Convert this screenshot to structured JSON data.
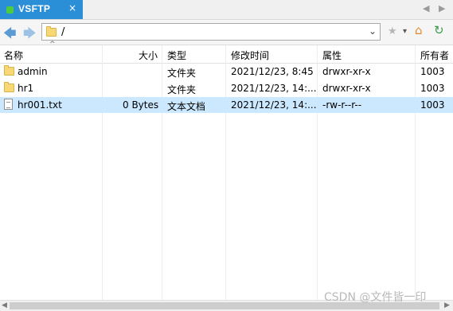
{
  "tab": {
    "title": "VSFTP",
    "close": "×"
  },
  "tab_nav": {
    "left": "◀",
    "right": "▶"
  },
  "toolbar": {
    "back": "🡄",
    "forward": "🡆",
    "path": "/",
    "path_dropdown": "⌄",
    "star": "★",
    "star_drop": "▾",
    "home": "⌂",
    "refresh": "↻"
  },
  "columns": {
    "name": "名称",
    "sort_indicator": "^",
    "size": "大小",
    "type": "类型",
    "modified": "修改时间",
    "attrs": "属性",
    "owner": "所有者"
  },
  "files": [
    {
      "name": "admin",
      "size": "",
      "type": "文件夹",
      "modified": "2021/12/23, 8:45",
      "attrs": "drwxr-xr-x",
      "owner": "1003",
      "icon": "folder-icon"
    },
    {
      "name": "hr1",
      "size": "",
      "type": "文件夹",
      "modified": "2021/12/23, 14:...",
      "attrs": "drwxr-xr-x",
      "owner": "1003",
      "icon": "folder-icon"
    },
    {
      "name": "hr001.txt",
      "size": "0 Bytes",
      "type": "文本文档",
      "modified": "2021/12/23, 14:...",
      "attrs": "-rw-r--r--",
      "owner": "1003",
      "icon": "text-file-icon",
      "selected": true
    }
  ],
  "scrollbar": {
    "left": "◀",
    "right": "▶"
  },
  "watermark": "CSDN @文件皆一印",
  "colors": {
    "tab_active": "#2b8fd8",
    "selection": "#cce8ff",
    "tab_indicator": "#4ecb3c"
  }
}
